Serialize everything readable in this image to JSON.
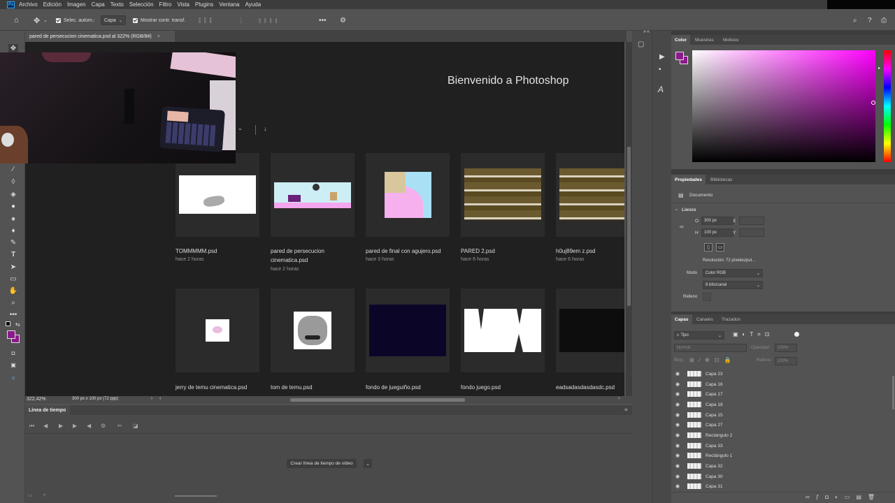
{
  "menubar": {
    "logo": "Ps",
    "items": [
      "Archivo",
      "Edición",
      "Imagen",
      "Capa",
      "Texto",
      "Selección",
      "Filtro",
      "Vista",
      "Plugins",
      "Ventana",
      "Ayuda"
    ]
  },
  "options": {
    "auto_select_label": "Selec. autom.:",
    "auto_select_value": "Capa",
    "transform_label": "Mostrar contr. transf."
  },
  "document": {
    "tab_title": "pared de persecucion cinematica.psd al 322% (RGB/8#)",
    "zoom": "322,42%",
    "doc_info": "300 px x 100 px (72 ppp)"
  },
  "welcome": {
    "title": "Bienvenido a Photoshop",
    "files": [
      {
        "name": "TOMMMMM.psd",
        "date": "hace 2 horas"
      },
      {
        "name": "pared de persecucion cinematica.psd",
        "date": "hace 2 horas"
      },
      {
        "name": "pared de final con agujero.psd",
        "date": "hace 3 horas"
      },
      {
        "name": "PARED 2.psd",
        "date": "hace 6 horas"
      },
      {
        "name": "h0uj89em z.psd",
        "date": "hace 6 horas"
      },
      {
        "name": "jerry de temu cinematica.psd",
        "date": ""
      },
      {
        "name": "tom de temu.psd",
        "date": ""
      },
      {
        "name": "fondo de jueguiño.psd",
        "date": ""
      },
      {
        "name": "fondo juego.psd",
        "date": ""
      },
      {
        "name": "eadsadasdasdasdc.psd",
        "date": ""
      }
    ]
  },
  "timeline": {
    "tab": "Línea de tiempo",
    "create_button": "Crear línea de tiempo de vídeo"
  },
  "color_panel": {
    "tabs": [
      "Color",
      "Muestras",
      "Motivos"
    ],
    "foreground": "#8b1a8b",
    "hue": "#ff00ff"
  },
  "properties_panel": {
    "tabs": [
      "Propiedades",
      "Bibliotecas"
    ],
    "section_document": "Documento",
    "section_canvas": "Lienzo",
    "width_label": "O",
    "width_value": "300 px",
    "height_label": "H",
    "height_value": "100 px",
    "x_label": "X",
    "y_label": "Y",
    "resolution": "Resolución: 72 píxeles/pul...",
    "mode_label": "Modo",
    "mode_value": "Color RGB",
    "depth_value": "8 bits/canal",
    "fill_label": "Relleno"
  },
  "layers_panel": {
    "tabs": [
      "Capas",
      "Canales",
      "Trazados"
    ],
    "filter": "Tipo",
    "blend": "Normal",
    "opacity_label": "Opacidad:",
    "opacity_value": "100%",
    "lock_label": "Bloq.:",
    "fill_label": "Relleno:",
    "fill_value": "100%",
    "layers": [
      "Capa 23",
      "Capa 16",
      "Capa 17",
      "Capa 18",
      "Capa 15",
      "Capa 27",
      "Rectángulo 2",
      "Capa 33",
      "Rectángulo 1",
      "Capa 32",
      "Capa 30",
      "Capa 31"
    ]
  }
}
